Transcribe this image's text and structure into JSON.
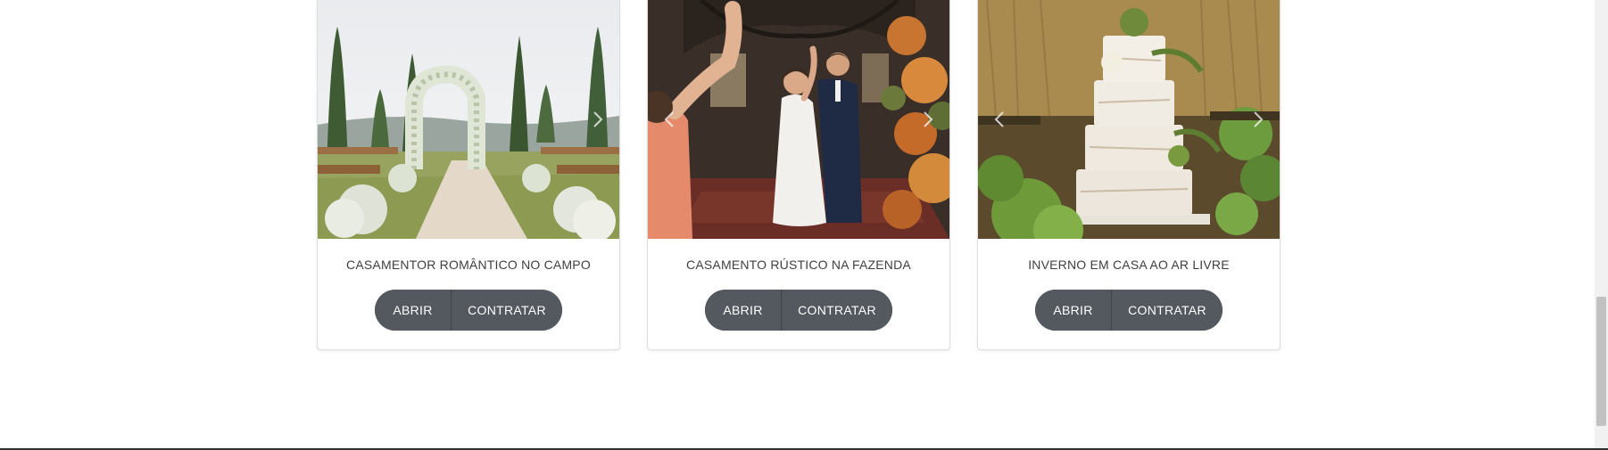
{
  "cards": [
    {
      "title": "CASAMENTOR ROMÂNTICO NO CAMPO",
      "image": "outdoor wedding aisle with floral arch",
      "open_label": "ABRIR",
      "hire_label": "CONTRATAR"
    },
    {
      "title": "CASAMENTO RÚSTICO NA FAZENDA",
      "image": "bride and groom celebrating in rustic barn",
      "open_label": "ABRIR",
      "hire_label": "CONTRATAR"
    },
    {
      "title": "INVERNO EM CASA AO AR LIVRE",
      "image": "naked wedding cake with green succulents",
      "open_label": "ABRIR",
      "hire_label": "CONTRATAR"
    }
  ],
  "icons": {
    "prev": "chevron-left-icon",
    "next": "chevron-right-icon"
  },
  "colors": {
    "button_bg": "#54595f",
    "button_text": "#ffffff",
    "title_text": "#3f3f3f",
    "card_border": "#dedede"
  }
}
